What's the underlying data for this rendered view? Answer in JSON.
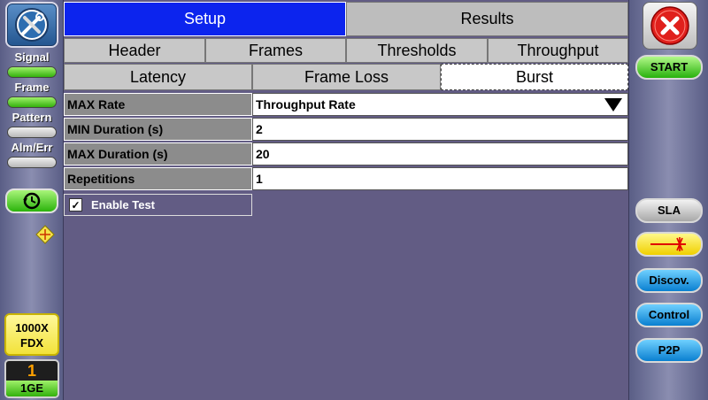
{
  "left": {
    "signal_label": "Signal",
    "frame_label": "Frame",
    "pattern_label": "Pattern",
    "alm_label": "Alm/Err",
    "mode_line1": "1000X",
    "mode_line2": "FDX",
    "port_number": "1",
    "port_speed": "1GE"
  },
  "tabs": {
    "primary": [
      "Setup",
      "Results"
    ],
    "secondary": [
      "Header",
      "Frames",
      "Thresholds",
      "Throughput"
    ],
    "tertiary": [
      "Latency",
      "Frame Loss",
      "Burst"
    ],
    "active_primary": "Setup",
    "active_tertiary": "Burst"
  },
  "form": {
    "max_rate": {
      "label": "MAX Rate",
      "value": "Throughput Rate"
    },
    "min_duration": {
      "label": "MIN Duration (s)",
      "value": "2"
    },
    "max_duration": {
      "label": "MAX Duration (s)",
      "value": "20"
    },
    "repetitions": {
      "label": "Repetitions",
      "value": "1"
    },
    "enable_test": {
      "label": "Enable Test",
      "checked": true
    }
  },
  "right": {
    "start": "START",
    "sla": "SLA",
    "discov": "Discov.",
    "control": "Control",
    "p2p": "P2P"
  },
  "colors": {
    "background": "#625c84",
    "active_tab": "#0c24ee",
    "green": "#33b10d",
    "blue": "#0a7fd0",
    "yellow": "#f2e23a",
    "close_red": "#e0201c"
  }
}
